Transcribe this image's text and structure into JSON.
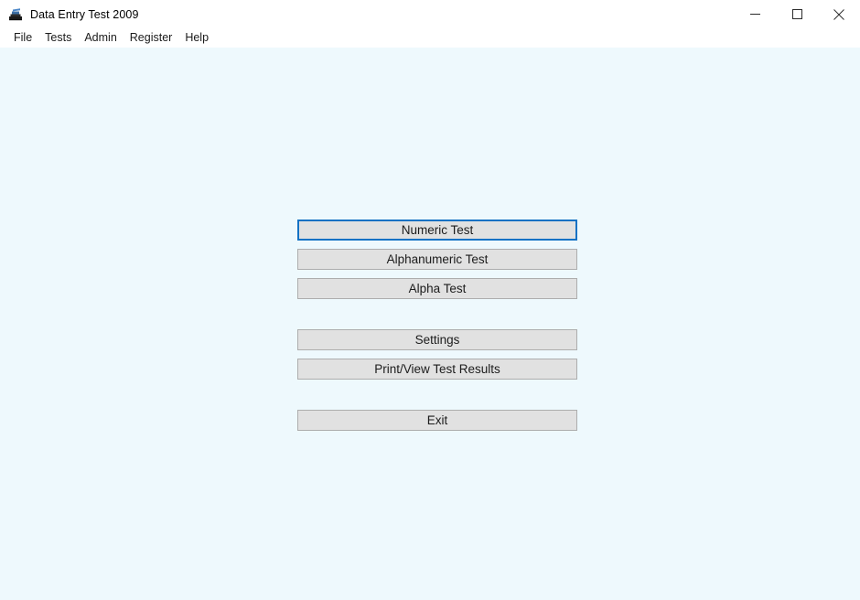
{
  "window": {
    "title": "Data Entry Test 2009",
    "icon": "typewriter-icon",
    "background_color": "#eef9fd",
    "titlebar_color": "#ffffff",
    "controls": {
      "minimize_label": "Minimize",
      "maximize_label": "Maximize",
      "close_label": "Close"
    }
  },
  "menu_bar": {
    "items": [
      {
        "label": "File"
      },
      {
        "label": "Tests"
      },
      {
        "label": "Admin"
      },
      {
        "label": "Register"
      },
      {
        "label": "Help"
      }
    ]
  },
  "main": {
    "buttons": [
      {
        "label": "Numeric Test",
        "focused": true
      },
      {
        "label": "Alphanumeric Test",
        "focused": false
      },
      {
        "label": "Alpha Test",
        "focused": false
      },
      {
        "label": "Settings",
        "focused": false
      },
      {
        "label": "Print/View Test Results",
        "focused": false
      },
      {
        "label": "Exit",
        "focused": false
      }
    ],
    "button_face_color": "#e1e1e1",
    "button_border_color": "#adadad",
    "focus_border_color": "#1472c4"
  }
}
